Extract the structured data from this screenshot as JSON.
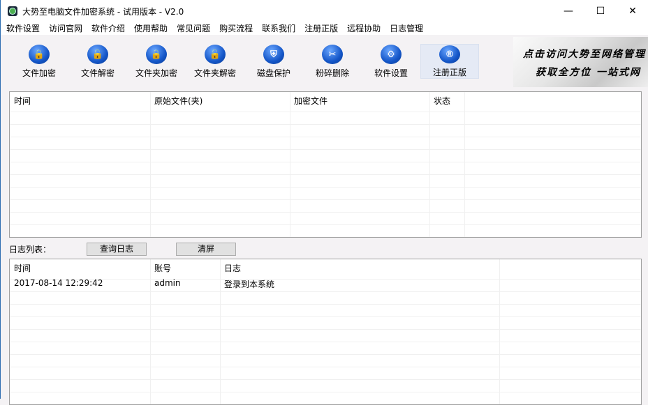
{
  "window": {
    "title": "大势至电脑文件加密系统 - 试用版本 - V2.0",
    "minimize": "—",
    "maximize": "☐",
    "close": "✕"
  },
  "menu": [
    "软件设置",
    "访问官网",
    "软件介绍",
    "使用帮助",
    "常见问题",
    "购买流程",
    "联系我们",
    "注册正版",
    "远程协助",
    "日志管理"
  ],
  "toolbar": [
    {
      "label": "文件加密",
      "icon": "file-lock-icon",
      "glyph": "🔒"
    },
    {
      "label": "文件解密",
      "icon": "file-unlock-icon",
      "glyph": "🔓"
    },
    {
      "label": "文件夹加密",
      "icon": "folder-lock-icon",
      "glyph": "🔒"
    },
    {
      "label": "文件夹解密",
      "icon": "folder-unlock-icon",
      "glyph": "🔓"
    },
    {
      "label": "磁盘保护",
      "icon": "disk-shield-icon",
      "glyph": "⛨"
    },
    {
      "label": "粉碎删除",
      "icon": "shred-icon",
      "glyph": "✂"
    },
    {
      "label": "软件设置",
      "icon": "gear-icon",
      "glyph": "⚙"
    },
    {
      "label": "注册正版",
      "icon": "registered-icon",
      "glyph": "®",
      "active": true
    }
  ],
  "banner": {
    "line1": "点击访问大势至网络管理",
    "line2": "获取全方位 一站式网"
  },
  "files_table": {
    "columns": [
      "时间",
      "原始文件(夹)",
      "加密文件",
      "状态"
    ],
    "rows": []
  },
  "log": {
    "label": "日志列表：",
    "query_button": "查询日志",
    "clear_button": "清屏",
    "columns": [
      "时间",
      "账号",
      "日志"
    ],
    "rows": [
      [
        "2017-08-14 12:29:42",
        "admin",
        "登录到本系统"
      ]
    ]
  },
  "colors": {
    "accent": "#1456c8",
    "active_tool": "#e5eaf5"
  }
}
